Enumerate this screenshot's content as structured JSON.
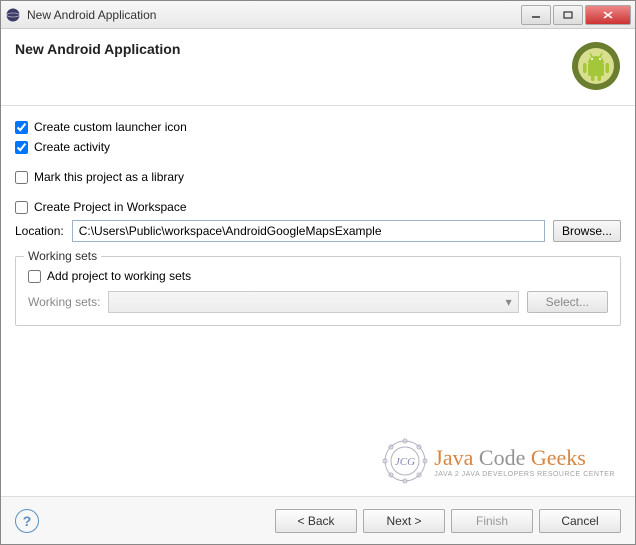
{
  "window": {
    "title": "New Android Application"
  },
  "header": {
    "title": "New Android Application",
    "subtitle": ""
  },
  "options": {
    "create_launcher_icon": {
      "label": "Create custom launcher icon",
      "checked": true
    },
    "create_activity": {
      "label": "Create activity",
      "checked": true
    },
    "mark_library": {
      "label": "Mark this project as a library",
      "checked": false
    },
    "create_in_workspace": {
      "label": "Create Project in Workspace",
      "checked": false
    }
  },
  "location": {
    "label": "Location:",
    "value": "C:\\Users\\Public\\workspace\\AndroidGoogleMapsExample",
    "browse": "Browse..."
  },
  "working_sets": {
    "legend": "Working sets",
    "add_label": "Add project to working sets",
    "add_checked": false,
    "label": "Working sets:",
    "select": "Select..."
  },
  "watermark": {
    "badge": "JCG",
    "main_java": "Java",
    "main_code": "Code",
    "main_geeks": "Geeks",
    "sub": "JAVA 2 JAVA DEVELOPERS RESOURCE CENTER"
  },
  "buttons": {
    "back": "< Back",
    "next": "Next >",
    "finish": "Finish",
    "cancel": "Cancel"
  }
}
